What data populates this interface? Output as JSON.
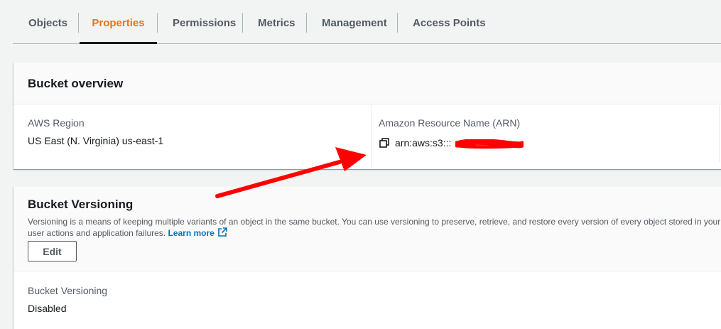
{
  "tabs": [
    {
      "label": "Objects",
      "active": false
    },
    {
      "label": "Properties",
      "active": true
    },
    {
      "label": "Permissions",
      "active": false
    },
    {
      "label": "Metrics",
      "active": false
    },
    {
      "label": "Management",
      "active": false
    },
    {
      "label": "Access Points",
      "active": false
    }
  ],
  "overview": {
    "title": "Bucket overview",
    "region_label": "AWS Region",
    "region_value": "US East (N. Virginia) us-east-1",
    "arn_label": "Amazon Resource Name (ARN)",
    "arn_value": "arn:aws:s3:::"
  },
  "versioning": {
    "title": "Bucket Versioning",
    "description_line1": "Versioning is a means of keeping multiple variants of an object in the same bucket. You can use versioning to preserve, retrieve, and restore every version of every object stored in your",
    "description_line2": "user actions and application failures.",
    "learn_more": "Learn more",
    "edit_label": "Edit",
    "status_label": "Bucket Versioning",
    "status_value": "Disabled"
  },
  "colors": {
    "active_tab": "#ec7211",
    "link": "#0073bb",
    "annotation_arrow": "#ff0000"
  },
  "icons": {
    "copy": "copy-icon",
    "external_link": "external-link-icon"
  }
}
